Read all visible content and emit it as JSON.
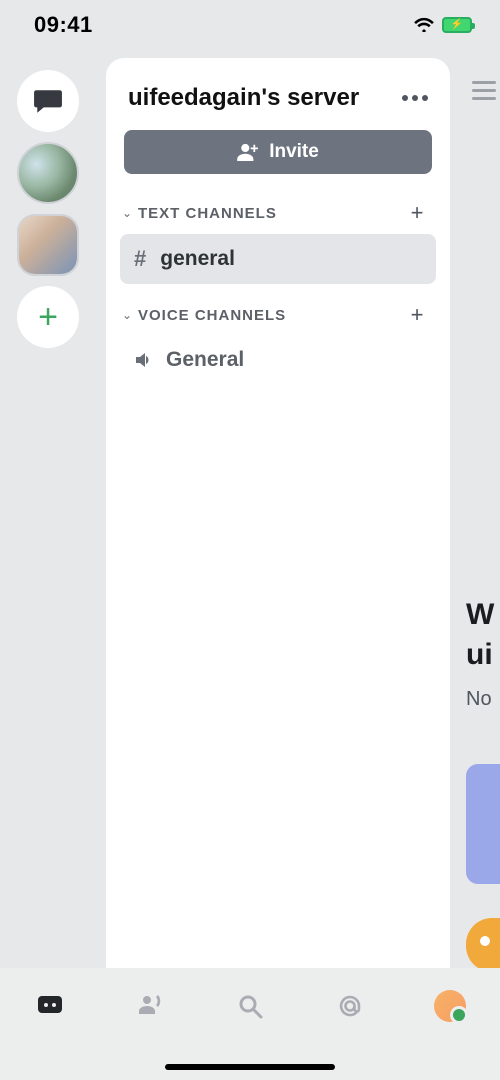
{
  "status": {
    "time": "09:41"
  },
  "server": {
    "title": "uifeedagain's server",
    "invite_label": "Invite"
  },
  "sections": {
    "text": {
      "label": "TEXT CHANNELS",
      "channels": [
        {
          "name": "general",
          "selected": true
        }
      ]
    },
    "voice": {
      "label": "VOICE CHANNELS",
      "channels": [
        {
          "name": "General"
        }
      ]
    }
  },
  "peek": {
    "line1": "W",
    "line2": "ui",
    "line3": "No"
  }
}
